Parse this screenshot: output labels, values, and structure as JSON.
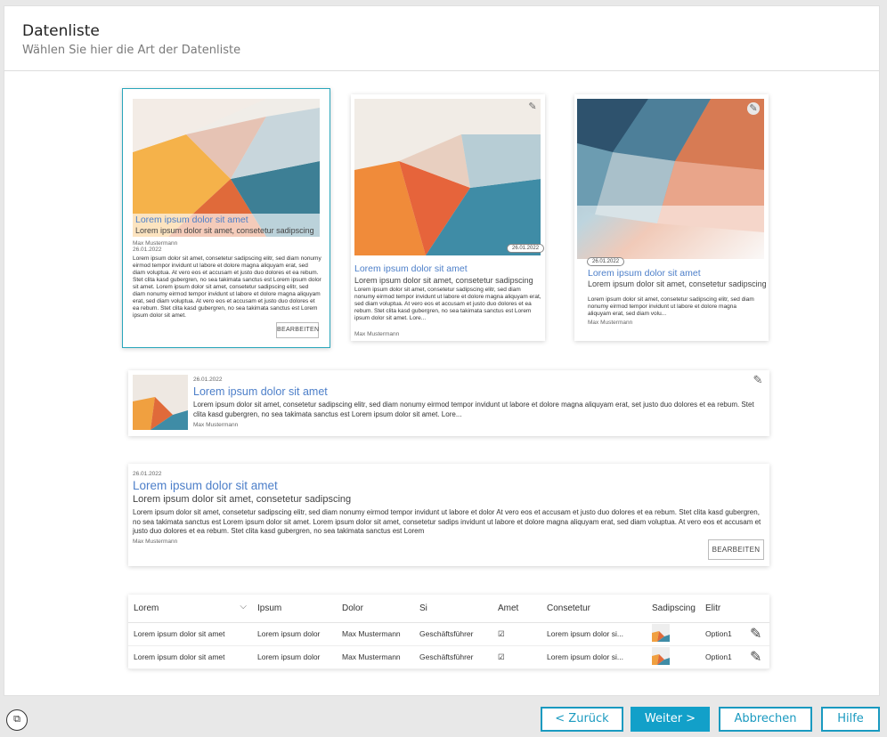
{
  "header": {
    "title": "Datenliste",
    "subtitle": "Wählen Sie hier die Art der Datenliste"
  },
  "lorem_title": "Lorem ipsum dolor sit amet",
  "lorem_sub": "Lorem ipsum dolor sit amet, consetetur sadipscing",
  "lorem_sub2": "Lorem ipsum dolor sit amet, consetetur sadipscing",
  "author": "Max Mustermann",
  "date": "26.01.2022",
  "card1_body": "Lorem ipsum dolor sit amet, consetetur sadipscing elitr, sed diam nonumy eirmod tempor invidunt ut labore et dolore magna aliquyam erat, sed diam voluptua. At vero eos et accusam et justo duo dolores et ea rebum. Stet clita kasd gubergren, no sea takimata sanctus est Lorem ipsum dolor sit amet. Lorem ipsum dolor sit amet, consetetur sadipscing elitr, sed diam nonumy eirmod tempor invidunt ut labore et dolore magna aliquyam erat, sed diam voluptua. At vero eos et accusam et justo duo dolores et ea rebum. Stet clita kasd gubergren, no sea takimata sanctus est Lorem ipsum dolor sit amet.",
  "card2_body": "Lorem ipsum dolor sit amet, consetetur sadipscing elitr, sed diam nonumy eirmod tempor invidunt ut labore et dolore magna aliquyam erat, sed diam voluptua. At vero eos et accusam et justo duo dolores et ea rebum. Stet clita kasd gubergren, no sea takimata sanctus est Lorem ipsum dolor sit amet. Lore...",
  "card3_body": "Lorem ipsum dolor sit amet, consetetur sadipscing elitr, sed diam nonumy eirmod tempor invidunt ut labore et dolore magna aliquyam erat, sed diam volu...",
  "list_body": "Lorem ipsum dolor sit amet, consetetur sadipscing elitr, sed diam nonumy eirmod tempor invidunt ut labore et dolore magna aliquyam erat, set justo duo dolores et ea rebum. Stet clita kasd gubergren, no sea takimata sanctus est Lorem ipsum dolor sit amet. Lore...",
  "wide_sub": "Lorem ipsum dolor sit amet, consetetur sadipscing",
  "wide_body": "Lorem ipsum dolor sit amet, consetetur sadipscing elitr, sed diam nonumy eirmod tempor invidunt ut labore et dolor  At vero eos et accusam et justo duo dolores et ea rebum. Stet clita kasd gubergren, no sea takimata sanctus est Lorem ipsum dolor sit amet. Lorem ipsum dolor sit amet, consetetur sadips invidunt ut labore et dolore magna aliquyam erat, sed diam voluptua. At vero eos et accusam et justo duo dolores et ea rebum. Stet clita kasd gubergren, no sea takimata sanctus est Lorem",
  "edit_label": "BEARBEITEN",
  "table": {
    "headers": [
      "Lorem",
      "Ipsum",
      "Dolor",
      "Si",
      "Amet",
      "Consetetur",
      "Sadipscing",
      "Elitr"
    ],
    "rows": [
      [
        "Lorem ipsum dolor sit amet",
        "Lorem ipsum dolor",
        "Max Mustermann",
        "Geschäftsführer",
        "☑",
        "Lorem ipsum dolor si...",
        "",
        "Option1"
      ],
      [
        "Lorem ipsum dolor sit amet",
        "Lorem ipsum dolor",
        "Max Mustermann",
        "Geschäftsführer",
        "☑",
        "Lorem ipsum dolor si...",
        "",
        "Option1"
      ]
    ]
  },
  "footer": {
    "back": "< Zurück",
    "next": "Weiter >",
    "cancel": "Abbrechen",
    "help": "Hilfe"
  },
  "icons": {
    "pencil": "pencil-icon",
    "dropdown": "chevron-down-icon",
    "corner": "window-icon",
    "check": "checkbox-icon"
  },
  "colors": {
    "accent": "#12a0c9",
    "link": "#4d7fc9",
    "selected_border": "#2aa6bb"
  }
}
